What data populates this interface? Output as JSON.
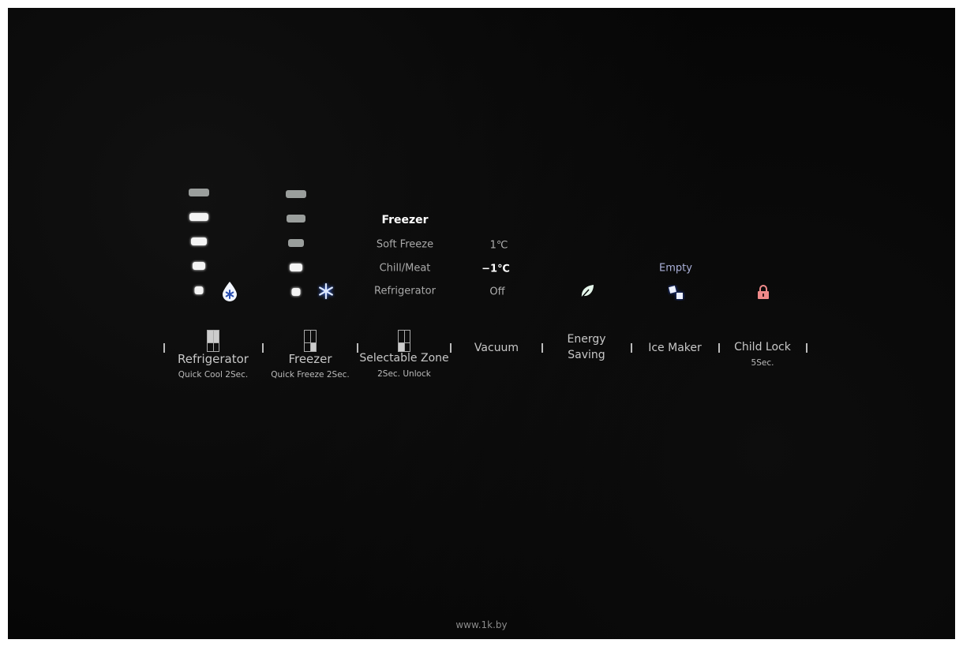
{
  "refrigerator_levels": {
    "steps": 5,
    "lit": [
      false,
      true,
      true,
      true,
      true
    ]
  },
  "freezer_levels": {
    "steps": 5,
    "lit": [
      false,
      false,
      false,
      true,
      true
    ]
  },
  "icons": {
    "refrigerator": "water-drop-snowflake-icon",
    "freezer": "snowflake-icon",
    "energy": "leaf-icon",
    "ice": "ice-cubes-icon",
    "lock": "padlock-icon"
  },
  "colors": {
    "blue": "#3d6fe0",
    "leaf": "#dff5e8",
    "lock": "#f08a8a",
    "ice": "#2a50d0"
  },
  "selectable_zone": {
    "modes": [
      {
        "label": "Freezer",
        "temp": "",
        "selected": true
      },
      {
        "label": "Soft Freeze",
        "temp": "1℃",
        "selected": false
      },
      {
        "label": "Chill/Meat",
        "temp": "−1℃",
        "selected": false
      },
      {
        "label": "Refrigerator",
        "temp": "Off",
        "selected": false
      }
    ]
  },
  "ice_maker_status": "Empty",
  "buttons": [
    {
      "label": "Refrigerator",
      "sub": "Quick Cool 2Sec."
    },
    {
      "label": "Freezer",
      "sub": "Quick Freeze 2Sec."
    },
    {
      "label": "Selectable Zone",
      "sub": "2Sec. Unlock"
    },
    {
      "label": "Vacuum",
      "sub": ""
    },
    {
      "label": "Energy",
      "label2": "Saving",
      "sub": ""
    },
    {
      "label": "Ice Maker",
      "sub": ""
    },
    {
      "label": "Child Lock",
      "sub": "5Sec."
    }
  ],
  "watermark": "www.1k.by"
}
